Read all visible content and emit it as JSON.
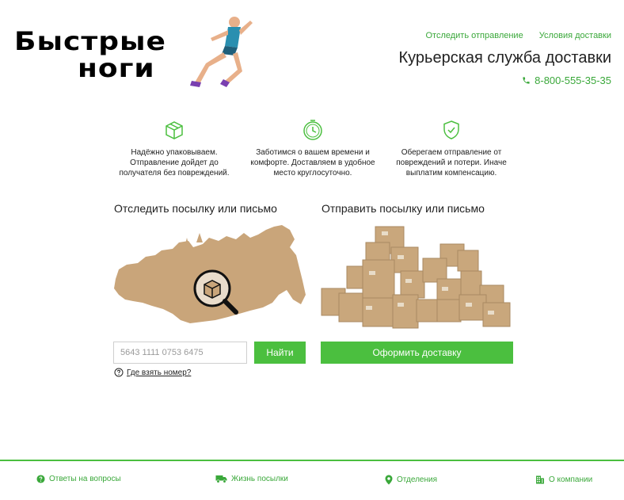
{
  "logo": {
    "line1": "Быстрые",
    "line2": "ноги"
  },
  "header": {
    "links": [
      "Отследить отправление",
      "Условия доставки"
    ],
    "tagline": "Курьерская служба доставки",
    "phone": "8-800-555-35-35"
  },
  "features": [
    {
      "icon": "package-icon",
      "text": "Надёжно упаковываем. Отправление дойдет до получателя без повреждений."
    },
    {
      "icon": "clock-icon",
      "text": "Заботимся о вашем времени и комфорте. Доставляем в удобное место круглосуточно."
    },
    {
      "icon": "shield-check-icon",
      "text": "Оберегаем отправление от повреждений и потери. Иначе выплатим компенсацию."
    }
  ],
  "track": {
    "title": "Отследить посылку или письмо",
    "placeholder": "5643 1111 0753 6475",
    "button": "Найти",
    "help": "Где взять номер?"
  },
  "send": {
    "title": "Отправить посылку или письмо",
    "button": "Оформить доставку"
  },
  "footer": {
    "items": [
      {
        "icon": "question-icon",
        "label": "Ответы на вопросы"
      },
      {
        "icon": "truck-icon",
        "label": "Жизнь посылки"
      },
      {
        "icon": "location-pin-icon",
        "label": "Отделения"
      },
      {
        "icon": "building-icon",
        "label": "О компании"
      }
    ]
  },
  "colors": {
    "accent": "#4bbf3f",
    "link": "#3aa83a",
    "map": "#c9a57a"
  }
}
